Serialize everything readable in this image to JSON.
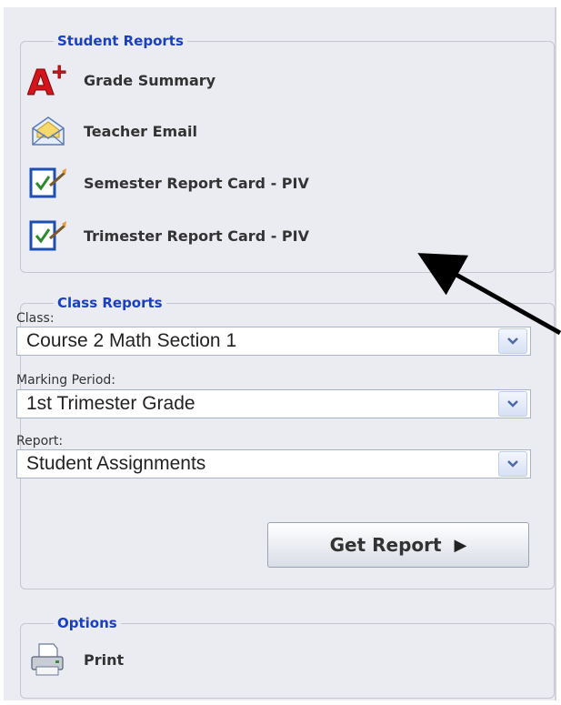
{
  "student_reports": {
    "title": "Student Reports",
    "items": [
      {
        "label": "Grade Summary",
        "icon": "a-plus-grade-icon"
      },
      {
        "label": "Teacher Email",
        "icon": "envelope-icon"
      },
      {
        "label": "Semester Report Card - PIV",
        "icon": "report-card-icon"
      },
      {
        "label": "Trimester Report Card - PIV",
        "icon": "report-card-icon"
      }
    ]
  },
  "class_reports": {
    "title": "Class Reports",
    "class_label": "Class:",
    "class_value": "Course 2 Math Section 1",
    "marking_label": "Marking Period:",
    "marking_value": "1st Trimester Grade",
    "report_label": "Report:",
    "report_value": "Student Assignments",
    "button_label": "Get Report",
    "button_arrow": "▶"
  },
  "options": {
    "title": "Options",
    "print_label": "Print",
    "print_icon": "printer-icon"
  },
  "colors": {
    "legend": "#1a3fbf",
    "panel_bg": "#ebebf2",
    "annotation_arrow": "#000000"
  }
}
